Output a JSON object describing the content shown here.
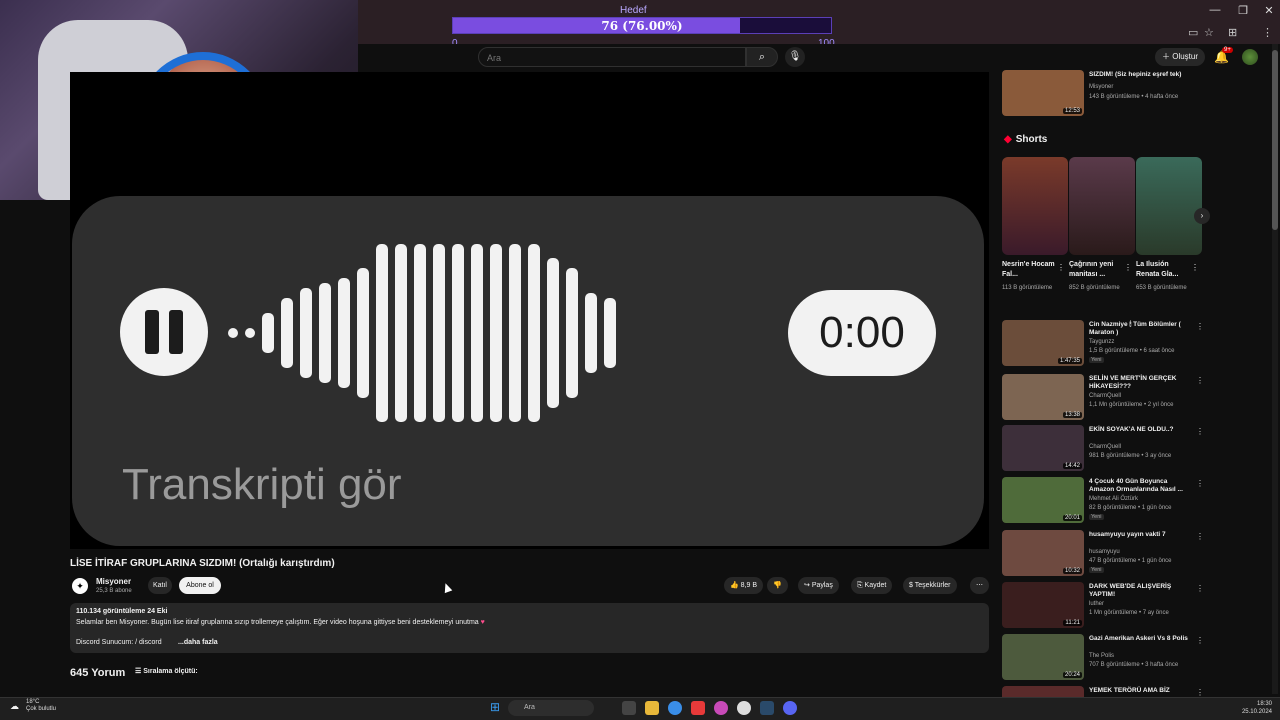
{
  "goal": {
    "label": "Hedef",
    "progress_text": "76 (76.00%)",
    "min": "0",
    "max": "100",
    "fraction": 0.76
  },
  "header": {
    "search_placeholder": "Ara",
    "create_label": "Oluştur",
    "notif_badge": "9+"
  },
  "player": {
    "time": "0:00",
    "transcript_label": "Transkripti gör"
  },
  "video": {
    "title": "LİSE İTİRAF GRUPLARINA SIZDIM! (Ortalığı karıştırdım)",
    "channel": "Misyoner",
    "subscribers": "25,3 B abone",
    "join_label": "Katıl",
    "subscribe_label": "Abone ol",
    "likes": "8,9 B",
    "share_label": "Paylaş",
    "save_label": "Kaydet",
    "thanks_label": "Teşekkürler",
    "views_line": "110.134 görüntüleme  24 Eki",
    "description": "Selamlar ben Misyoner. Bugün lise itiraf gruplarına sızıp trollemeye çalıştım. Eğer video hoşuna gittiyse beni desteklemeyi unutma",
    "discord_line": "Discord Sunucum: / discord",
    "more_label": "...daha fazla",
    "comments_count": "645 Yorum",
    "sort_label": "Sıralama ölçütü:"
  },
  "sidebar_top": {
    "title": "SIZDIM! (Siz hepiniz eşref tek)",
    "channel": "Misyoner",
    "meta": "143 B görüntüleme • 4 hafta önce",
    "duration": "12:53"
  },
  "shorts": {
    "header": "Shorts",
    "items": [
      {
        "title": "Nesrin'e Hocam Fal...",
        "views": "113 B görüntüleme"
      },
      {
        "title": "Çağrının yeni manitası ...",
        "views": "852 B görüntüleme"
      },
      {
        "title": "La Ilusión Renata Gla...",
        "views": "653 B görüntüleme"
      }
    ]
  },
  "sidebar": [
    {
      "title": "Cin Nazmiye 🕯 Tüm Bölümler ( Maraton )",
      "channel": "Taygunzz",
      "meta": "1,5 B görüntüleme • 6 saat önce",
      "badge": "Yeni",
      "duration": "1:47:35",
      "color": "#6b4d3a"
    },
    {
      "title": "SELİN VE MERT'İN GERÇEK HİKAYESİ???",
      "channel": "CharmQuell",
      "meta": "1,1 Mn görüntüleme • 2 yıl önce",
      "badge": "",
      "duration": "13:38",
      "color": "#7d6552"
    },
    {
      "title": "EKİN SOYAK'A NE OLDU..?",
      "channel": "CharmQuell",
      "meta": "981 B görüntüleme • 3 ay önce",
      "badge": "",
      "duration": "14:42",
      "color": "#3d2f3a"
    },
    {
      "title": "4 Çocuk 40 Gün Boyunca Amazon Ormanlarında Nasıl ...",
      "channel": "Mehmet Ali Öztürk",
      "meta": "82 B görüntüleme • 1 gün önce",
      "badge": "Yeni",
      "duration": "20:01",
      "color": "#4f6b3a"
    },
    {
      "title": "husamyuyu yayın vakti 7",
      "channel": "husamyuyu",
      "meta": "47 B görüntüleme • 1 gün önce",
      "badge": "Yeni",
      "duration": "10:32",
      "color": "#6e4a40"
    },
    {
      "title": "DARK WEB'DE ALIŞVERİŞ YAPTIM!",
      "channel": "luther",
      "meta": "1 Mn görüntüleme • 7 ay önce",
      "badge": "",
      "duration": "11:21",
      "color": "#3a1e1e"
    },
    {
      "title": "Gazi Amerikan Askeri Vs 8 Polis",
      "channel": "The Polis",
      "meta": "707 B görüntüleme • 3 hafta önce",
      "badge": "",
      "duration": "20:24",
      "color": "#4d5a3d"
    },
    {
      "title": "YEMEK TERÖRÜ AMA BİZ",
      "channel": "",
      "meta": "",
      "badge": "",
      "duration": "",
      "color": "#5a2a2a"
    }
  ],
  "taskbar": {
    "weather_temp": "18°C",
    "weather_desc": "Çok bulutlu",
    "search_placeholder": "Ara",
    "time": "18:30",
    "date": "25.10.2024"
  },
  "colors": {
    "accent_goal": "#7a4de0",
    "yt_red": "#ff0033",
    "bg": "#0f0f0f"
  }
}
